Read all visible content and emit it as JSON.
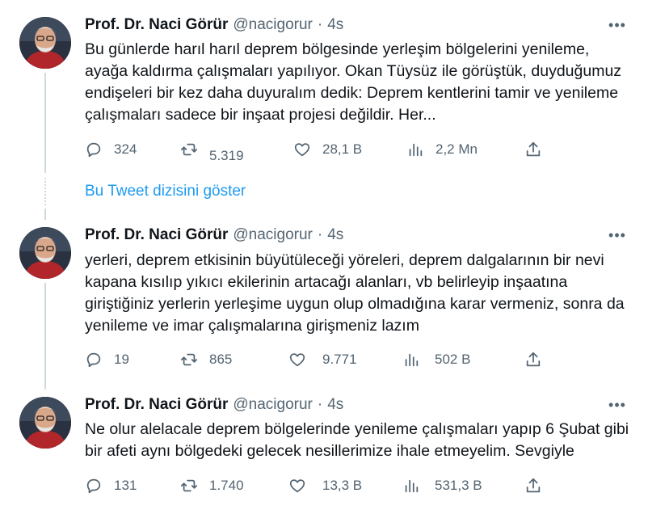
{
  "author": {
    "name": "Prof. Dr. Naci Görür",
    "handle": "@nacigorur",
    "separator": "·"
  },
  "more_icon": "more-horizontal-icon",
  "icons": {
    "reply": "reply-icon",
    "retweet": "retweet-icon",
    "like": "like-icon",
    "views": "views-icon",
    "share": "share-icon"
  },
  "accent_color": "#1d9bf0",
  "show_thread_label": "Bu Tweet dizisini göster",
  "tweets": [
    {
      "time": "4s",
      "text": "Bu günlerde harıl harıl deprem bölgesinde yerleşim bölgelerini yenileme, ayağa kaldırma çalışmaları yapılıyor. Okan Tüysüz ile görüştük, duyduğumuz endişeleri bir kez daha duyuralım dedik: Deprem kentlerini tamir ve yenileme çalışmaları sadece bir inşaat projesi değildir. Her...",
      "replies": "324",
      "retweets": "5.319",
      "likes": "28,1 B",
      "views": "2,2 Mn"
    },
    {
      "time": "4s",
      "text": "yerleri, deprem etkisinin büyütüleceği yöreleri, deprem dalgalarının bir nevi kapana kısılıp yıkıcı ekilerinin artacağı alanları, vb belirleyip inşaatına giriştiğiniz yerlerin yerleşime uygun olup olmadığına karar vermeniz, sonra da yenileme ve imar çalışmalarına girişmeniz lazım",
      "replies": "19",
      "retweets": "865",
      "likes": "9.771",
      "views": "502 B"
    },
    {
      "time": "4s",
      "text": "Ne olur alelacale deprem bölgelerinde yenileme çalışmaları yapıp 6 Şubat gibi bir afeti aynı bölgedeki gelecek nesillerimize ihale etmeyelim. Sevgiyle",
      "replies": "131",
      "retweets": "1.740",
      "likes": "13,3 B",
      "views": "531,3 B"
    }
  ]
}
